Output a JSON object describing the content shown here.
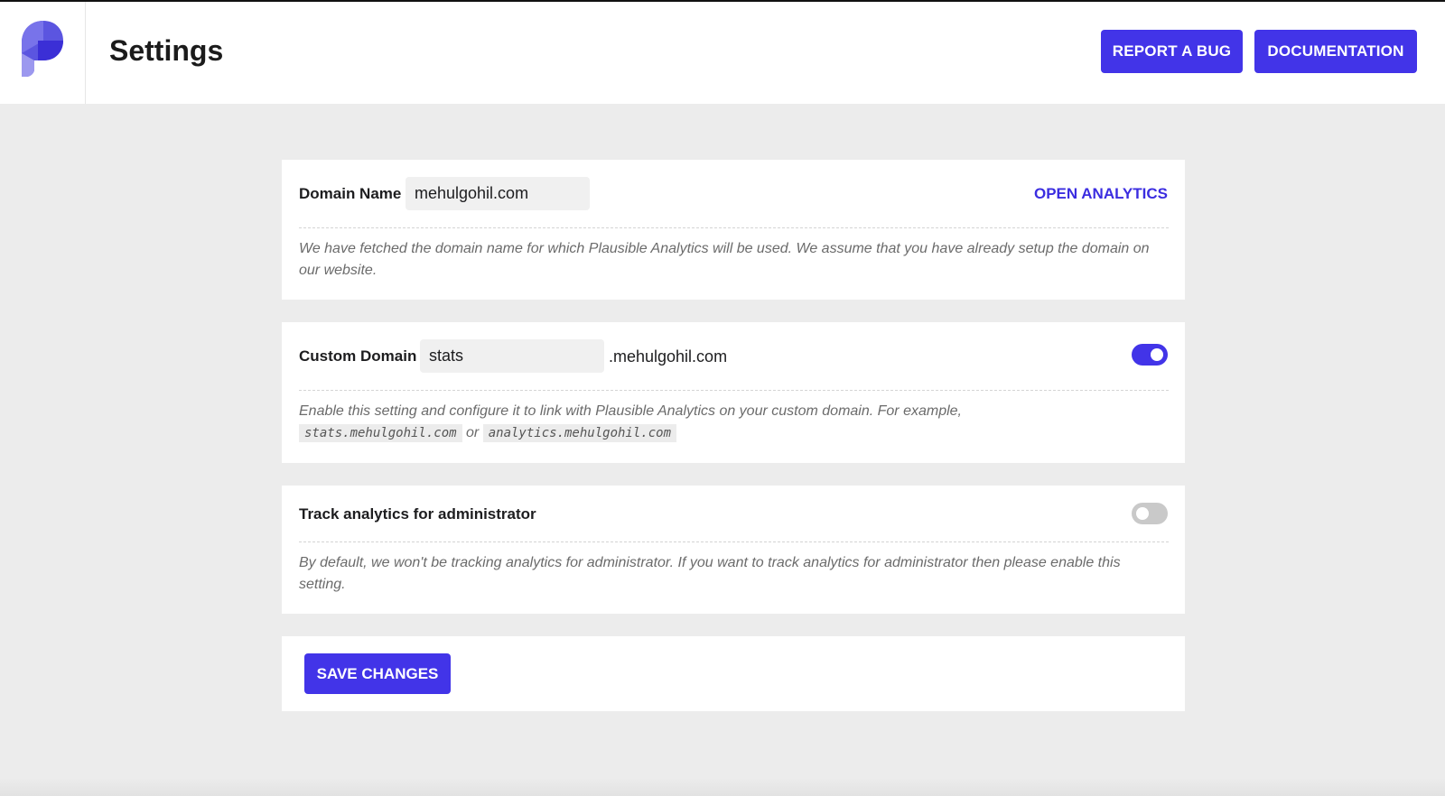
{
  "header": {
    "title": "Settings",
    "report_bug_label": "REPORT A BUG",
    "documentation_label": "DOCUMENTATION"
  },
  "domain_card": {
    "label": "Domain Name",
    "value": "mehulgohil.com",
    "open_analytics_label": "OPEN ANALYTICS",
    "help": "We have fetched the domain name for which Plausible Analytics will be used. We assume that you have already setup the domain on our website."
  },
  "custom_domain_card": {
    "label": "Custom Domain",
    "value": "stats",
    "suffix": ".mehulgohil.com",
    "enabled": true,
    "help_prefix": "Enable this setting and configure it to link with Plausible Analytics on your custom domain. For example,",
    "example1": "stats.mehulgohil.com",
    "or_text": "or",
    "example2": "analytics.mehulgohil.com"
  },
  "admin_card": {
    "label": "Track analytics for administrator",
    "enabled": false,
    "help": "By default, we won't be tracking analytics for administrator. If you want to track analytics for administrator then please enable this setting."
  },
  "save_label": "SAVE CHANGES",
  "colors": {
    "accent": "#4234e8",
    "background": "#ececec",
    "toggle_off": "#c9c9c9"
  }
}
